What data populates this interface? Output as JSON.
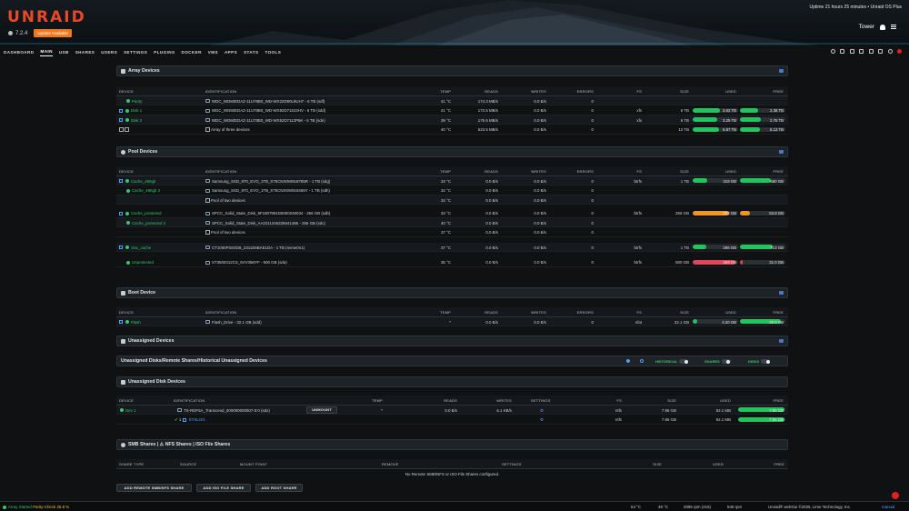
{
  "header": {
    "logo": "UNRAID",
    "version": "7.2.4",
    "update_badge": "Update Available",
    "uptime": "Uptime 21 hours 25 minutes • Unraid OS Plus",
    "server": "Tower"
  },
  "nav": {
    "tabs": [
      "DASHBOARD",
      "MAIN",
      "USB",
      "SHARES",
      "USERS",
      "SETTINGS",
      "PLUGINS",
      "DOCKER",
      "VMS",
      "APPS",
      "STATS",
      "TOOLS"
    ],
    "active": "MAIN"
  },
  "array": {
    "title": "Array Devices",
    "headers": [
      "DEVICE",
      "IDENTIFICATION",
      "TEMP",
      "READS",
      "WRITES",
      "ERRORS",
      "FS",
      "SIZE",
      "USED",
      "FREE"
    ],
    "rows": [
      {
        "device": "Parity",
        "id": "WDC_WD60EDAZ-11U78B0_WD-WX22D80L9UH7 - 6 TB (sdf)",
        "temp": "41 °C",
        "reads": "174.3 MB/s",
        "writes": "0.0 B/s",
        "errors": "0",
        "fs": "",
        "size": "",
        "used": "",
        "free": ""
      },
      {
        "device": "Disk 1",
        "id": "WDC_WD60EDAZ-11U78B0_WD-WX82D71522HV - 6 TB (sdd)",
        "temp": "41 °C",
        "reads": "173.5 MB/s",
        "writes": "0.0 B/s",
        "errors": "0",
        "fs": "xfs",
        "size": "6 TB",
        "used": "3.62 TB",
        "free": "2.38 TB",
        "used_frac": 0.6,
        "free_frac": 0.4
      },
      {
        "device": "Disk 2",
        "id": "WDC_WD60EDAZ-11U78B0_WD-WX62D7113P6K - 6 TB (sde)",
        "temp": "39 °C",
        "reads": "175.6 MB/s",
        "writes": "0.0 B/s",
        "errors": "0",
        "fs": "xfs",
        "size": "6 TB",
        "used": "3.25 TB",
        "free": "2.75 TB",
        "used_frac": 0.54,
        "free_frac": 0.46
      },
      {
        "device": "",
        "id": "Array of three devices",
        "temp": "40 °C",
        "reads": "523.5 MB/s",
        "writes": "0.0 B/s",
        "errors": "0",
        "fs": "",
        "size": "12 TB",
        "used": "6.87 TB",
        "free": "5.13 TB",
        "used_frac": 0.57,
        "free_frac": 0.43
      }
    ]
  },
  "pool": {
    "title": "Pool Devices",
    "headers": [
      "DEVICE",
      "IDENTIFICATION",
      "TEMP",
      "READS",
      "WRITES",
      "ERRORS",
      "FS",
      "SIZE",
      "USED",
      "FREE"
    ],
    "rows": [
      {
        "device": "Cache_480gb",
        "id": "Samsung_SSD_870_EVO_1TB_S75CNX0W918785R - 1 TB (sdg)",
        "temp": "33 °C",
        "reads": "0.0 B/s",
        "writes": "0.0 B/s",
        "errors": "0",
        "fs": "btrfs",
        "size": "1 TB",
        "used": "318 GB",
        "free": "680 GB",
        "used_frac": 0.32,
        "free_frac": 0.68,
        "link": true
      },
      {
        "device": "Cache_480gb 2",
        "id": "Samsung_SSD_870_EVO_1TB_S75CNX0W918465Y - 1 TB (sdh)",
        "temp": "34 °C",
        "reads": "0.0 B/s",
        "writes": "0.0 B/s",
        "errors": "0",
        "fs": "",
        "size": "",
        "used": "",
        "free": ""
      },
      {
        "device": "",
        "id": "Pool of two devices",
        "temp": "34 °C",
        "reads": "0.0 B/s",
        "writes": "0.0 B/s",
        "errors": "0",
        "fs": "",
        "size": "",
        "used": "",
        "free": ""
      },
      {
        "device": "Cache_protected",
        "id": "SPCC_Solid_State_Disk_9F1807991D5000248034 - 256 GB (sdb)",
        "temp": "33 °C",
        "reads": "0.0 B/s",
        "writes": "0.0 B/s",
        "errors": "0",
        "fs": "btrfs",
        "size": "256 GB",
        "used": "202 GB",
        "free": "53.8 GB",
        "used_frac": 0.79,
        "free_frac": 0.21,
        "link": true,
        "warn": true
      },
      {
        "device": "Cache_protected 2",
        "id": "SPCC_Solid_State_Disk_AA2211245325641486 - 256 GB (sdc)",
        "temp": "40 °C",
        "reads": "0.0 B/s",
        "writes": "0.0 B/s",
        "errors": "0",
        "fs": "",
        "size": "",
        "used": "",
        "free": ""
      },
      {
        "device": "",
        "id": "Pool of two devices",
        "temp": "37 °C",
        "reads": "0.0 B/s",
        "writes": "0.0 B/s",
        "errors": "0",
        "fs": "",
        "size": "",
        "used": "",
        "free": ""
      },
      {
        "device": "1tsc_cache",
        "id": "CT1000P3SSD8_2311E6BAE1DA - 1 TB (nvme0n1)",
        "temp": "37 °C",
        "reads": "0.0 B/s",
        "writes": "0.0 B/s",
        "errors": "0",
        "fs": "btrfs",
        "size": "1 TB",
        "used": "286 GB",
        "free": "713 GB",
        "used_frac": 0.29,
        "free_frac": 0.71,
        "link": true
      },
      {
        "device": "Unprotected",
        "id": "ST3500312CS_5VV35KFF - 500 GB (sda)",
        "temp": "35 °C",
        "reads": "0.0 B/s",
        "writes": "0.0 B/s",
        "errors": "0",
        "fs": "btrfs",
        "size": "500 GB",
        "used": "469 GB",
        "free": "31.0 GB",
        "used_frac": 0.94,
        "free_frac": 0.06,
        "crit": true
      }
    ]
  },
  "boot": {
    "title": "Boot Device",
    "headers": [
      "DEVICE",
      "IDENTIFICATION",
      "TEMP",
      "READS",
      "WRITES",
      "ERRORS",
      "FS",
      "SIZE",
      "USED",
      "FREE"
    ],
    "row": {
      "device": "Flash",
      "id": "Flash_Drive - 32.1 GB (sdd)",
      "temp": "*",
      "reads": "0.0 B/s",
      "writes": "0.0 B/s",
      "errors": "0",
      "fs": "vfat",
      "size": "32.1 GB",
      "used": "3.20 GB",
      "free": "28.9 GB",
      "used_frac": 0.1,
      "free_frac": 0.9
    }
  },
  "unassigned": {
    "title": "Unassigned Devices",
    "shares_title": "Unassigned Disks/Remote Shares/Historical Unassigned Devices",
    "toggles": [
      "HISTORICAL",
      "SHARES",
      "DISKS"
    ],
    "disk_title": "Unassigned Disk Devices",
    "headers": [
      "DEVICE",
      "IDENTIFICATION",
      "TEMP",
      "READS",
      "WRITES",
      "SETTINGS",
      "FS",
      "SIZE",
      "USED",
      "FREE"
    ],
    "row": {
      "device": "Dev 1",
      "id": "TS-RDF5A_Transcend_000000000007-0:0 (sdx)",
      "button": "UNMOUNT",
      "temp": "*",
      "reads": "0.0 B/s",
      "writes": "6.1 KB/s",
      "fs": "ntfs",
      "size": "7.95 GB",
      "used": "92.1 MB",
      "free": "7.86 GB",
      "free_frac": 0.99
    },
    "sub": {
      "label": "1",
      "syslog": "SYSLOG",
      "fs": "ntfs",
      "size": "7.95 GB",
      "used": "92.1 MB",
      "free": "7.86 GB",
      "free_frac": 0.99
    }
  },
  "smb": {
    "title": "SMB Shares | ⚠ NFS Shares | ISO File Shares",
    "headers": [
      "SHARE TYPE",
      "SOURCE",
      "MOUNT POINT",
      "REMOVE",
      "SETTINGS",
      "SIZE",
      "USED",
      "FREE"
    ],
    "empty": "No Remote SMB/NFS or ISO File Shares configured.",
    "buttons": [
      "ADD REMOTE SMB/NFS SHARE",
      "ADD ISO FILE SHARE",
      "ADD ROOT SHARE"
    ]
  },
  "footer": {
    "status": "Array Started",
    "parity": "Parity-Check 25.8 %",
    "temp1": "64 °C",
    "temp2": "49 °C",
    "rpm": "2096 rpm (415)",
    "rpm2": "940 rpm",
    "copyright": "Unraid® webGui ©2025, Lime Technology, Inc.",
    "manual": "manual"
  },
  "colors": {
    "accent": "#e8482a",
    "green": "#22c45e",
    "orange": "#f0951e",
    "red": "#e0455a",
    "bg": "#0f1113"
  }
}
